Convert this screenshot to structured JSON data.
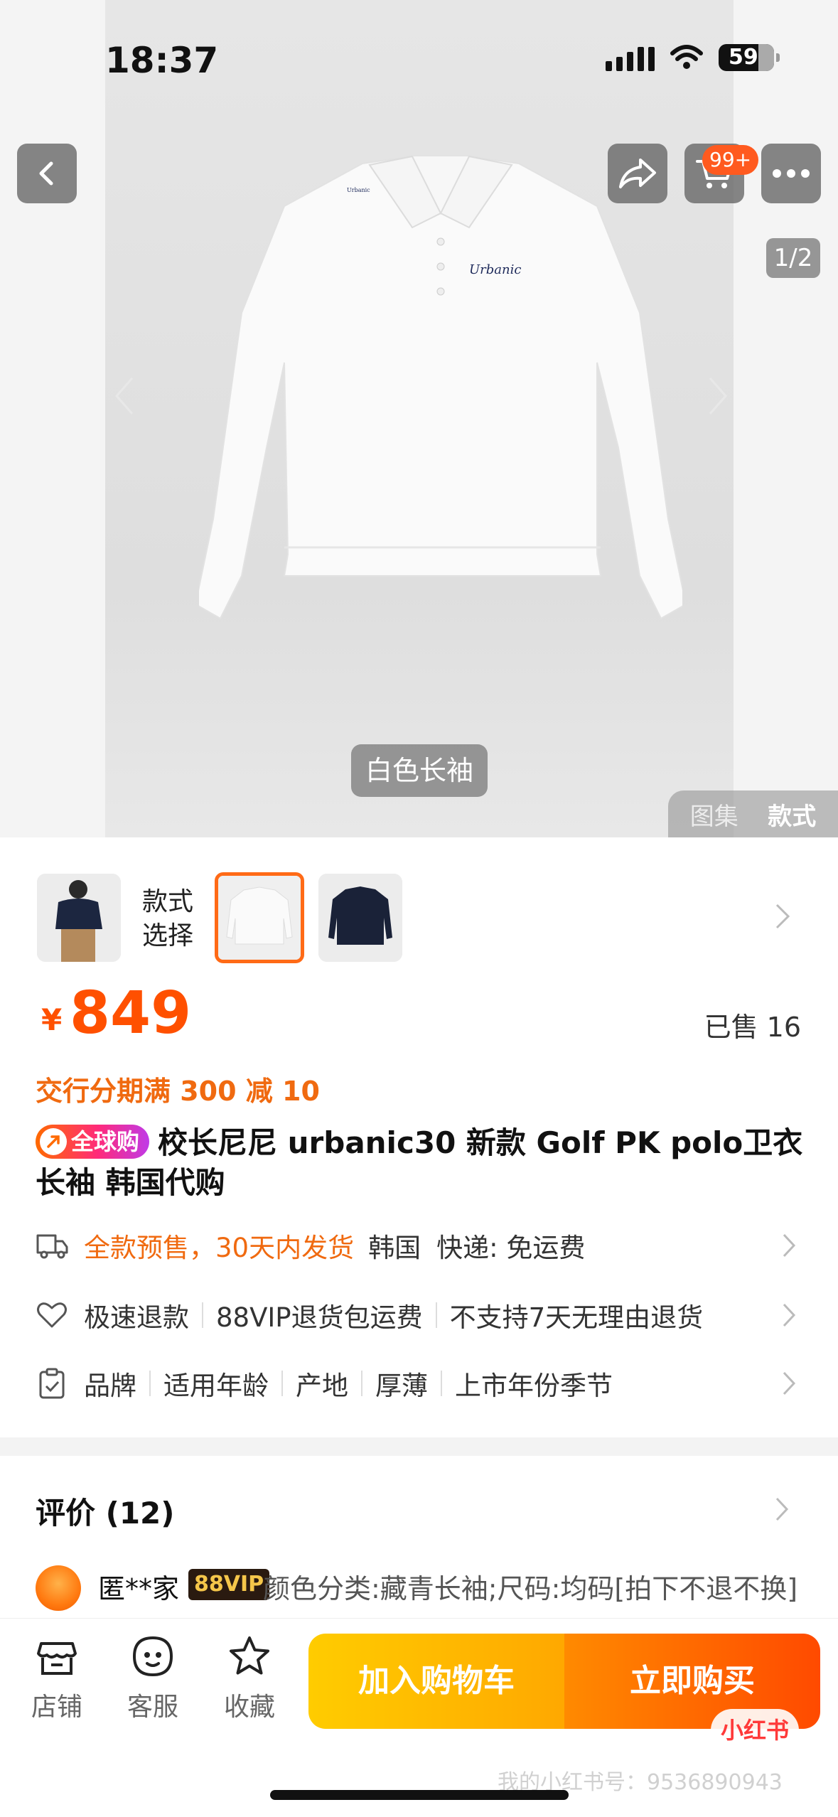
{
  "status": {
    "time": "18:37",
    "battery": "59"
  },
  "hero": {
    "cart_badge": "99+",
    "page_indicator": "1/2",
    "color_label": "白色长袖",
    "view_tabs": [
      "图集",
      "款式"
    ],
    "garment_logo": "Urbanic"
  },
  "style_selector": {
    "label": "款式\n选择"
  },
  "price": {
    "currency": "¥",
    "value": "849",
    "sold": "已售 16"
  },
  "promo": "交行分期满 300 减 10",
  "product": {
    "badge": "全球购",
    "title": "校长尼尼 urbanic30 新款 Golf PK polo卫衣长袖 韩国代购"
  },
  "shipping": {
    "presale": "全款预售，30天内发货",
    "origin": "韩国",
    "express": "快递: 免运费"
  },
  "refund": {
    "items": [
      "极速退款",
      "88VIP退货包运费",
      "不支持7天无理由退货"
    ]
  },
  "attributes": {
    "items": [
      "品牌",
      "适用年龄",
      "产地",
      "厚薄",
      "上市年份季节"
    ]
  },
  "reviews": {
    "title": "评价 (12)",
    "first": {
      "name": "匿**家",
      "badge": "88VIP",
      "text": "颜色分类:藏青长袖;尺码:均码[拍下不退不换]"
    }
  },
  "bottom_bar": {
    "store": "店铺",
    "service": "客服",
    "favorite": "收藏",
    "add_cart": "加入购物车",
    "buy_now": "立即购买",
    "wm_badge": "小红书",
    "watermark": "我的小红书号：9536890943"
  },
  "colors": {
    "accent": "#ff5000",
    "promo": "#f06a10",
    "cart_btn": "#ffb800",
    "buy_btn": "#ff5a00"
  }
}
